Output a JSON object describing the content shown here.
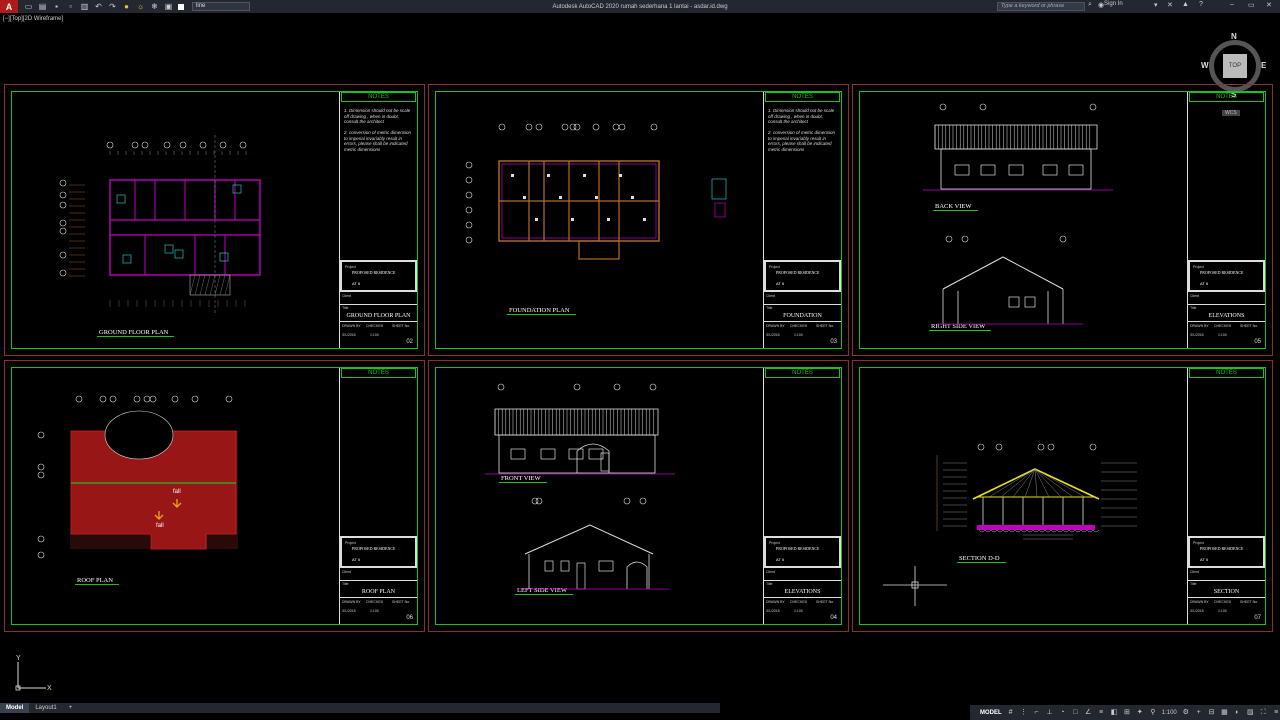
{
  "titlebar": {
    "app_letter": "A",
    "window_title": "Autodesk AutoCAD 2020   rumah sederhana 1 lantai - asdar.id.dwg",
    "layer_value": "line",
    "search_placeholder": "Type a keyword or phrase",
    "signin_label": "Sign In"
  },
  "viewport": {
    "label": "[−][Top][2D Wireframe]"
  },
  "viewcube": {
    "face": "TOP",
    "north": "N",
    "south": "S",
    "east": "E",
    "west": "W",
    "wcs": "WCS"
  },
  "notes_heading": "NOTES",
  "notes_text": [
    "1. Dimension should not be scale off drawing , when in doubt, consult the architect",
    "2. conversion of metric dimension to imperial invariably result in errors, please shall be indicated metric dimensions"
  ],
  "titleblock": {
    "project_label": "Project",
    "project_name": "PROPOSED RESIDENCE",
    "project_code": "AT II",
    "client_label": "Client",
    "title_label": "Title",
    "drawn_label": "DRAWN BY",
    "checked_label": "CHECKED",
    "sheet_label": "SHEET No.",
    "date": "3/1/2018",
    "scale": "1:100"
  },
  "sheets": [
    {
      "caption": "GROUND FLOOR PLAN",
      "title": "GROUND FLOOR PLAN",
      "number": "02",
      "has_notes": true
    },
    {
      "caption": "FOUNDATION PLAN",
      "title": "FOUNDATION",
      "number": "03",
      "has_notes": true
    },
    {
      "caption": "BACK VIEW",
      "caption2": "RIGHT SIDE VIEW",
      "title": "ELEVATIONS",
      "number": "05",
      "has_notes": false
    },
    {
      "caption": "ROOF PLAN",
      "title": "ROOF PLAN",
      "number": "06",
      "has_notes": false
    },
    {
      "caption": "FRONT VIEW",
      "caption2": "LEFT SIDE VIEW",
      "title": "ELEVATIONS",
      "number": "04",
      "has_notes": false
    },
    {
      "caption": "SECTION D-D",
      "title": "SECTION",
      "number": "07",
      "has_notes": false
    }
  ],
  "roof_labels": {
    "fall": "fall"
  },
  "ucs": {
    "x": "X",
    "y": "Y"
  },
  "layout_tabs": [
    {
      "label": "Model",
      "active": true
    },
    {
      "label": "Layout1",
      "active": false
    },
    {
      "label": "+",
      "active": false
    }
  ],
  "statusbar": {
    "mode": "MODEL",
    "scale": "1:100"
  },
  "colors": {
    "frame_green": "#1fbf1f",
    "sheet_border": "#8a3030",
    "wall_magenta": "#c000c0",
    "roof_red": "#b01818",
    "app_red": "#b11a1a"
  }
}
